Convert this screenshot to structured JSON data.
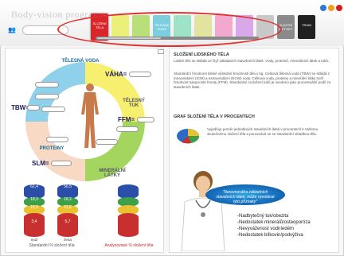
{
  "app": {
    "title": "Body-vision program"
  },
  "search": {
    "placeholder": ""
  },
  "tabs": [
    {
      "label": "SLOŽENÍ TĚLA",
      "color": "#d8262b"
    },
    {
      "label": "",
      "color": "#eaf07a"
    },
    {
      "label": "",
      "color": "#b9df79"
    },
    {
      "label": "TĚLESNÁ VODA",
      "color": "#7dcfe0"
    },
    {
      "label": "",
      "color": "#9ee3c7"
    },
    {
      "label": "",
      "color": "#e3e3a0"
    },
    {
      "label": "",
      "color": "#f2a8cf"
    },
    {
      "label": "",
      "color": "#d8a8e8"
    },
    {
      "label": "",
      "color": "#c8c8c8"
    },
    {
      "label": "VLASTNÍ METODY",
      "color": "#8a8a8a"
    },
    {
      "label": "TRAIN",
      "color": "#202020"
    }
  ],
  "window_buttons": {
    "colors": [
      "#2a7ad8",
      "#f0a020",
      "#d02020"
    ]
  },
  "diagram": {
    "water_label": "TĚLESNÁ VODA",
    "fat_label": "TĚLESNÝ TUK",
    "protein_label": "PROTEINY",
    "mineral_label": "MINERÁLNÍ LÁTKY",
    "vaha": "VÁHA=",
    "tbw": "TBW=",
    "ffm": "FFM=",
    "slm": "SLM=",
    "unit": "kg"
  },
  "cylinders": {
    "std_label": "Standardní % složení těla",
    "analyzed_label": "Analyzované % složení těla",
    "male_label": "muž",
    "female_label": "žena",
    "male": [
      "62,4",
      "18,3",
      "15,9",
      "3,4"
    ],
    "female": [
      "56,5",
      "16,2",
      "21,6",
      "5,7"
    ]
  },
  "right": {
    "title1": "SLOŽENÍ LIDSKÉHO TĚLA",
    "para1": "Lidské tělo se skládá ze čtyř základních stavebních látek. Vody, proteinů, minerálních látek a tuků.",
    "para2": "Standardní hmotnost lidské výsledné hmotnosti těla v kg. Celková tělesná voda (TBW) se skládá z intracelulární (ICW) a extracelulární (ECW) vody. Celková voda, proteiny a minerální látky tvoří hmotnost tukuprosté hmoty (FFM). Standardní rozložení tuků je uvedeno jako procentuální podíl ze stavebních látek.",
    "title2": "GRAF SLOŽENÍ TĚLA V PROCENTECH",
    "para3": "Vyjadřuje poměr jednotlivých stavebních látek v procentech k Vašemu skutečnému složení těla a porovnává se se standardní skladbou těla.",
    "bubble": "\"Nerovnováha základních stavebních látek, může vyvolávat tyto příznaky\"",
    "symptoms": [
      "-Nadbytečný tuk/obezita",
      "-Nedostatek minerálů/osteoporóza",
      "-Nevyváženost vodníedém",
      "-Nedostatek bílkovin/podvýživa"
    ]
  }
}
